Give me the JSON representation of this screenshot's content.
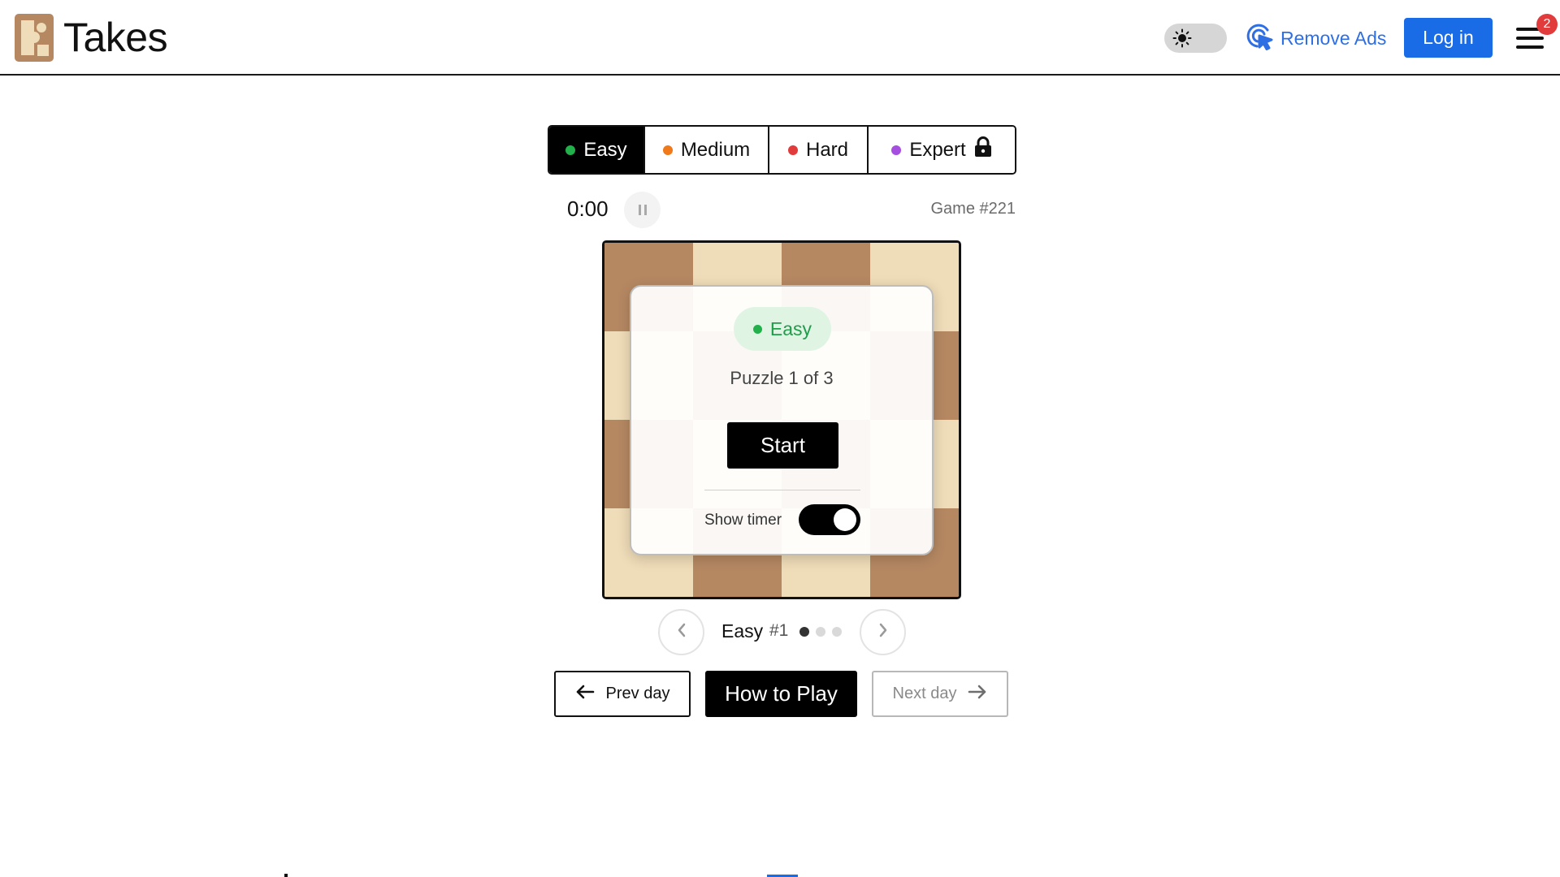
{
  "header": {
    "brand": "Takes",
    "remove_ads_label": "Remove Ads",
    "login_label": "Log in",
    "notification_count": "2"
  },
  "tabs": [
    {
      "label": "Easy",
      "color": "#22b04b",
      "active": true
    },
    {
      "label": "Medium",
      "color": "#f07a1a",
      "active": false
    },
    {
      "label": "Hard",
      "color": "#e23b3b",
      "active": false
    },
    {
      "label": "Expert",
      "color": "#a54ee0",
      "active": false,
      "locked": true
    }
  ],
  "timer": {
    "value": "0:00",
    "game_number": "Game #221"
  },
  "overlay": {
    "difficulty": "Easy",
    "subtitle": "Puzzle 1 of 3",
    "start_label": "Start",
    "show_timer_label": "Show timer",
    "show_timer_on": true
  },
  "puzzle_nav": {
    "label": "Easy",
    "number": "#1",
    "total": 3,
    "current": 1
  },
  "buttons": {
    "prev_day": "Prev day",
    "how_to_play": "How to Play",
    "next_day": "Next day"
  },
  "colors": {
    "accent": "#1a6be6",
    "board_dark": "#b58862",
    "board_light": "#efdcb8",
    "easy_green": "#22b04b"
  },
  "icons": {
    "theme": "sun-icon",
    "remove_ads": "cursor-click-icon",
    "menu": "hamburger-icon",
    "lock": "lock-icon",
    "pause": "pause-icon",
    "prev": "chevron-left-icon",
    "next": "chevron-right-icon",
    "prev_day": "arrow-left-icon",
    "next_day": "arrow-right-icon"
  }
}
